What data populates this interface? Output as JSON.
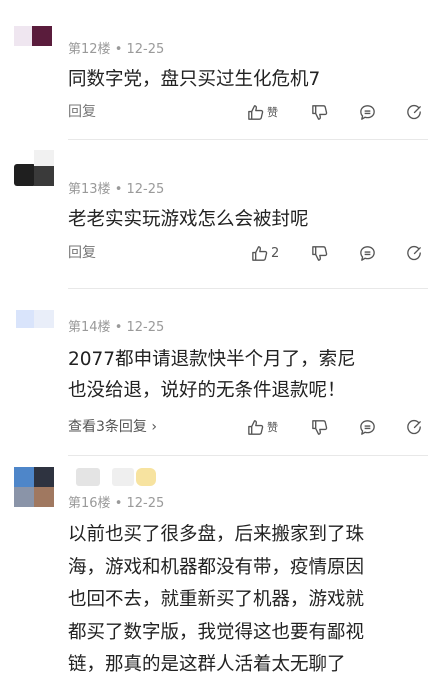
{
  "comments": [
    {
      "floor": "第12楼",
      "date": "12-25",
      "text": "同数字党，盘只买过生化危机7",
      "reply_label": "回复",
      "like_label": "赞",
      "like_count": ""
    },
    {
      "floor": "第13楼",
      "date": "12-25",
      "text": "老老实实玩游戏怎么会被封呢",
      "reply_label": "回复",
      "like_label": "",
      "like_count": "2"
    },
    {
      "floor": "第14楼",
      "date": "12-25",
      "text_lines": [
        "2077都申请退款快半个月了，索尼",
        "也没给退，说好的无条件退款呢！"
      ],
      "reply_label": "查看3条回复 ›",
      "like_label": "赞",
      "like_count": ""
    },
    {
      "floor": "第16楼",
      "date": "12-25",
      "text_lines": [
        "以前也买了很多盘，后来搬家到了珠",
        "海，游戏和机器都没有带，疫情原因",
        "也回不去，就重新买了机器，游戏就",
        "都买了数字版，我觉得这也要有鄙视",
        "链，那真的是这群人活着太无聊了"
      ]
    }
  ],
  "dot": "•",
  "icons": [
    "thumb-up-icon",
    "thumb-down-icon",
    "comment-icon",
    "share-icon"
  ]
}
